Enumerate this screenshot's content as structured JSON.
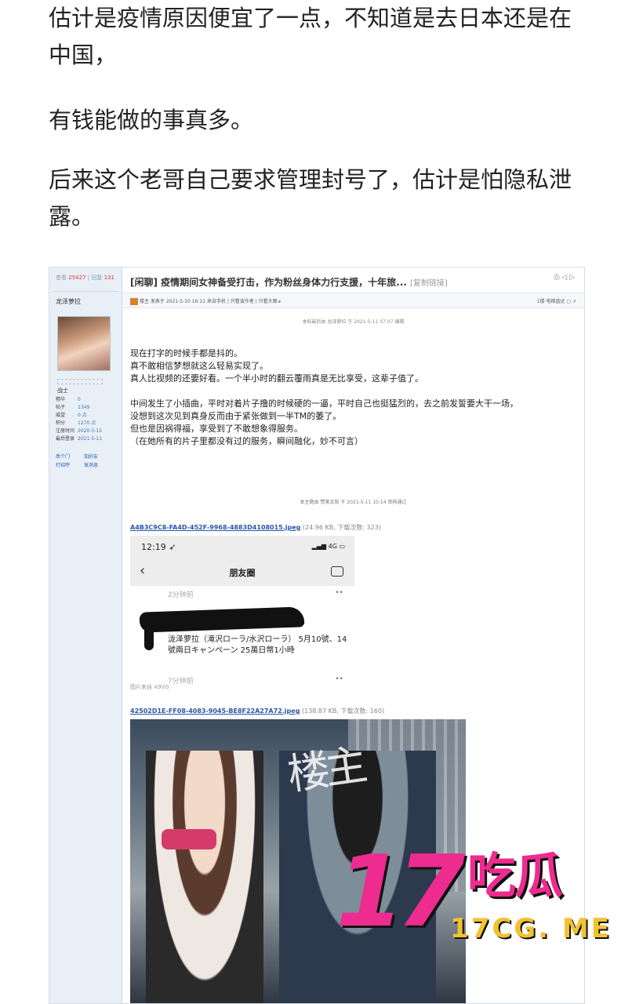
{
  "article": {
    "p1": "估计是疫情原因便宜了一点，不知道是去日本还是在中国，",
    "p2": "有钱能做的事真多。",
    "p3": "后来这个老哥自己要求管理封号了，估计是怕隐私泄露。"
  },
  "forum": {
    "stats_views_label": "查看",
    "stats_views": "25427",
    "stats_replies_label": "回复",
    "stats_replies": "131",
    "username": "龙泽萝拉",
    "rank": "战士",
    "profile": [
      {
        "k": "精华",
        "v": "0"
      },
      {
        "k": "帖子",
        "v": "1349"
      },
      {
        "k": "威望",
        "v": "0 点"
      },
      {
        "k": "积分",
        "v": "1270 点"
      },
      {
        "k": "注册时间",
        "v": "2020-5-15"
      },
      {
        "k": "最后登录",
        "v": "2021-5-11"
      }
    ],
    "side_links": [
      "串个门",
      "加好友",
      "打招呼",
      "发消息"
    ],
    "title": "[闲聊] 疫情期间女神备受打击，作为粉丝身体力行支援，十年旅...",
    "copy_link": "[复制链接]",
    "top_icons": "⎙ ◁ ▷",
    "meta_left": "楼主  发表于 2021-5-10 16:11 来自手机  |  只看该作者  |  只看大图 ▸",
    "meta_right": "1楼  电梯直达 ▢ ➚",
    "edit_note": "本帖最后由 龙泽萝拉 于 2021-5-11 07:07 编辑",
    "body_lines": [
      "现在打字的时候手都是抖的。",
      "真不敢相信梦想就这么轻易实现了。",
      "真人比视频的还要好看。一个半小时的翻云覆雨真是无比享受，这辈子值了。",
      "",
      "中间发生了小插曲，平时对着片子撸的时候硬的一逼，平时自己也挺猛烈的，去之前发誓要大干一场，",
      "没想到这次见到真身反而由于紧张做到一半TM的萎了。",
      "但也是因祸得福，享受到了不敢想象得服务。",
      "（在她所有的片子里都没有过的服务，瞬间融化，妙不可言）"
    ],
    "approve_note": "本主题由 赞美太阳 于 2021-5-11 10:14 审核通过",
    "attachment1_name": "A4B3C9C8-FA4D-452F-9968-4883D4108015.jpeg",
    "attachment1_info": " (24.96 KB, 下载次数: 323)",
    "attachment2_name": "42502D1E-FF08-4083-9045-BE8F22A27A72.jpeg",
    "attachment2_info": " (138.87 KB, 下载次数: 160)"
  },
  "phone": {
    "time": "12:19 ➶",
    "signal": "▂▄▆ 4G ▭",
    "back": "‹",
    "nav_title": "朋友圈",
    "time_ago_1": "2分钟前",
    "post_text": "泷泽萝拉（滝沢ローラ/水沢ローラ） 5月10號、14號兩日キャンペーン 25萬日幣1小時",
    "time_ago_2": "7分钟前",
    "dots": "••",
    "image_source": "图片来自 A9VG"
  },
  "photo": {
    "signature": "楼主"
  },
  "watermark": {
    "number": "17",
    "chinese": "吃瓜",
    "url": "17CG. ME"
  },
  "colors": {
    "watermark_pink": "#ee2b8f",
    "watermark_yellow": "#f2c230",
    "link_blue": "#2b56a6",
    "sidebar_bg": "#e8eff7"
  }
}
